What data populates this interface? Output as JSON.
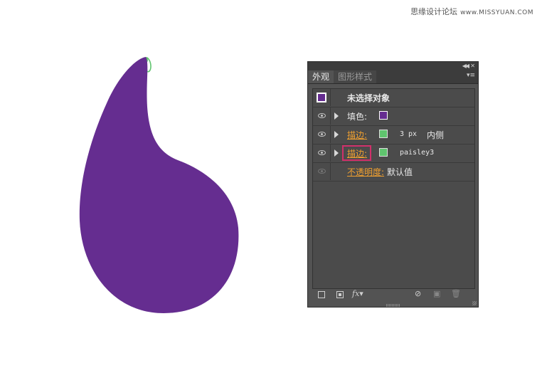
{
  "watermark": {
    "cn": "思缘设计论坛",
    "site": "www.MISSYUAN.COM"
  },
  "colors": {
    "fill": "#652d90",
    "stroke": "#5fc46e",
    "panel_bg": "#535353",
    "link": "#f0a030",
    "highlight": "#d0306a"
  },
  "panel": {
    "tabs": [
      {
        "label": "外观",
        "active": true
      },
      {
        "label": "图形样式",
        "active": false
      }
    ],
    "icons": [
      "collapse-icon",
      "close-icon",
      "panel-menu-icon"
    ],
    "header_row": {
      "label": "未选择对象"
    },
    "fill_row": {
      "label": "填色:"
    },
    "stroke_row_1": {
      "label": "描边:",
      "weight": "3 px",
      "align": "内侧"
    },
    "stroke_row_2": {
      "label": "描边:",
      "brush": "paisley3"
    },
    "opacity_row": {
      "label": "不透明度:",
      "value": "默认值"
    },
    "bottom_icons": [
      "add-new-stroke-icon",
      "add-new-fill-icon",
      "add-new-effect-icon",
      "clear-appearance-icon",
      "duplicate-item-icon",
      "delete-item-icon"
    ],
    "fx_label": "fx"
  }
}
